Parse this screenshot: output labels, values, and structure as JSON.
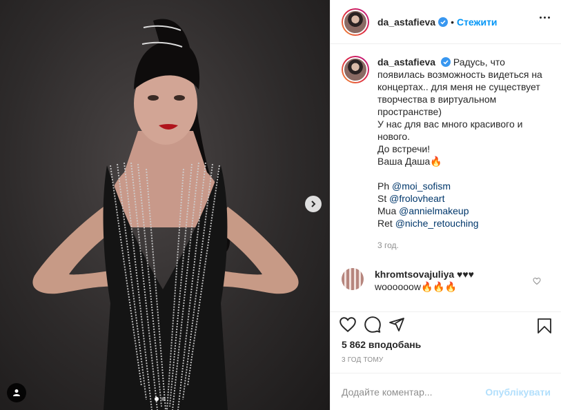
{
  "post_author": {
    "username": "da_astafieva",
    "separator": "•",
    "follow_label": "Стежити"
  },
  "caption": {
    "username": "da_astafieva",
    "text_lines": [
      "Радусь, что",
      "появилась возможность видеться на",
      "концертах.. для меня не существует",
      "творчества в виртуальном",
      "пространстве)",
      "У нас для вас много красивого и",
      "нового.",
      "До встречи!",
      "Ваша Даша🔥"
    ],
    "credits": [
      {
        "prefix": "Ph ",
        "mention": "@moi_sofism"
      },
      {
        "prefix": "St ",
        "mention": "@frolovheart"
      },
      {
        "prefix": "Mua ",
        "mention": "@annielmakeup"
      },
      {
        "prefix": "Ret ",
        "mention": "@niche_retouching"
      }
    ],
    "time": "3 год."
  },
  "comment": {
    "username": "khromtsovajuliya",
    "text_inline": "♥♥♥",
    "text_second": "woooooow🔥🔥🔥"
  },
  "likes": "5 862 вподобань",
  "posted_ago": "3 ГОД ТОМУ",
  "add_comment": {
    "placeholder": "Додайте коментар...",
    "post_label": "Опублікувати"
  },
  "carousel": {
    "slides": 2,
    "active_index": 0
  },
  "colors": {
    "accent": "#0095f6",
    "mention": "#00376b",
    "muted": "#8e8e8e",
    "post_disabled": "#b2dffc"
  }
}
